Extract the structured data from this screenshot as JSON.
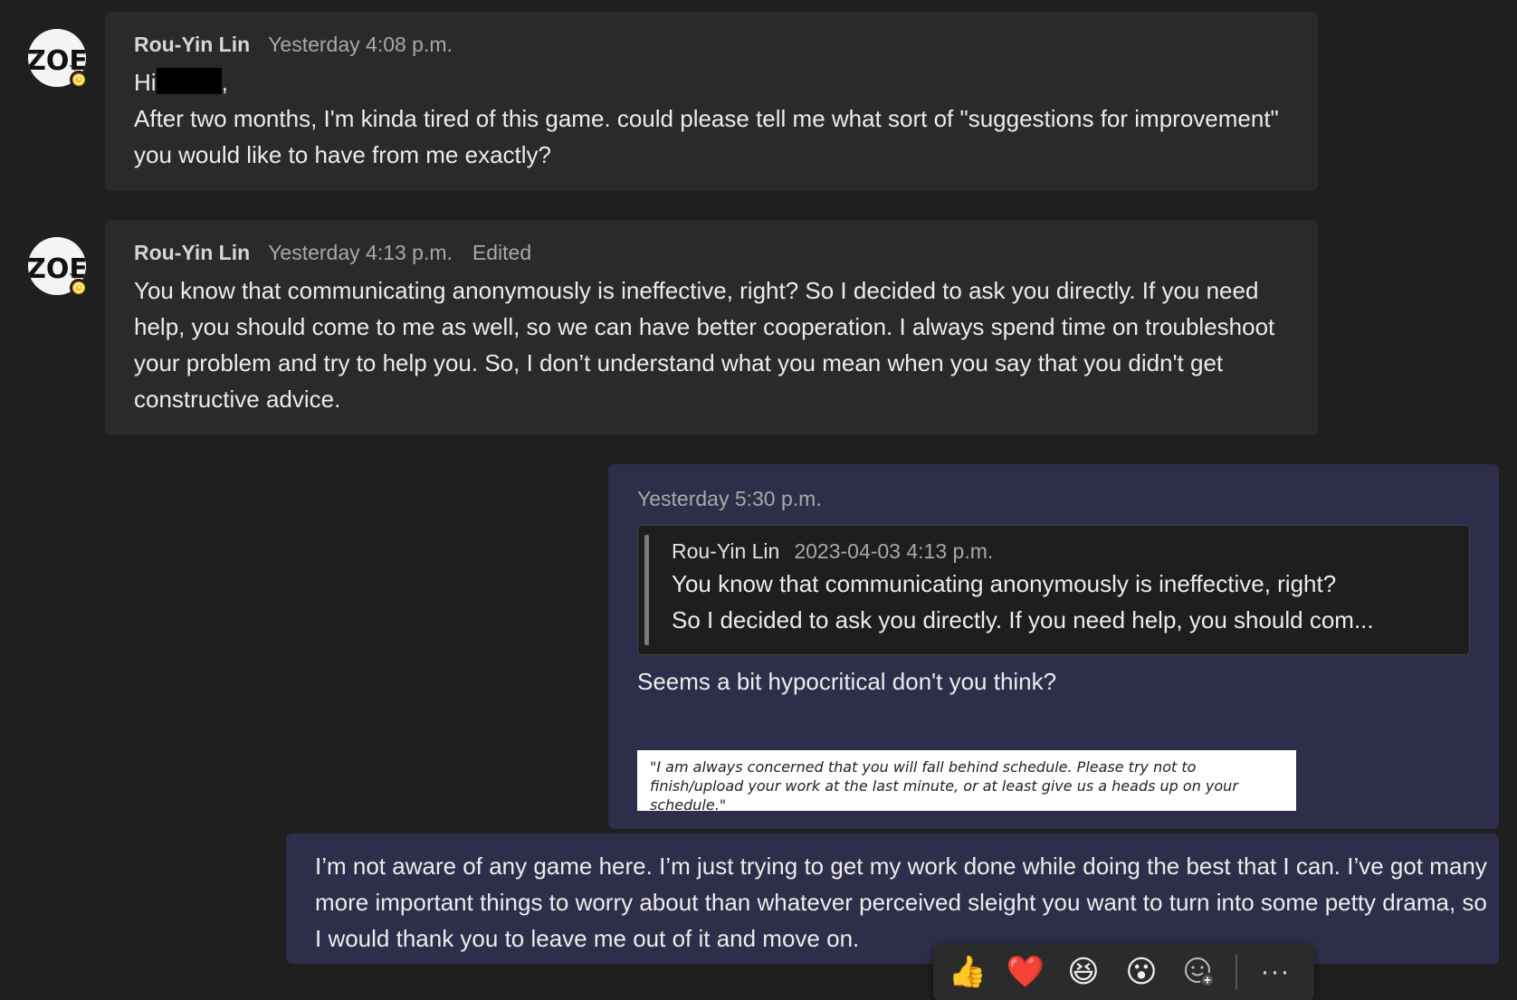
{
  "messages": [
    {
      "sender": "Rou-Yin Lin",
      "time": "Yesterday 4:08 p.m.",
      "greeting": "Hi",
      "greeting_suffix": ",",
      "body": "After two months, I'm kinda tired of this game. could please tell me what sort of \"suggestions for improvement\" you would like to have from me exactly?",
      "avatar_text": "ZOE"
    },
    {
      "sender": "Rou-Yin Lin",
      "time": "Yesterday 4:13 p.m.",
      "edited": "Edited",
      "body": "You know that communicating anonymously is ineffective, right? So I decided to ask you directly. If you need help, you should come to me as well, so we can have better cooperation. I always spend time on troubleshoot your problem and try to help you. So, I don’t understand what you mean when you say that you didn't get constructive advice.",
      "avatar_text": "ZOE"
    }
  ],
  "reply": {
    "time": "Yesterday 5:30 p.m.",
    "quote": {
      "sender": "Rou-Yin Lin",
      "time": "2023-04-03 4:13 p.m.",
      "line1": "You know that communicating anonymously is ineffective, right?",
      "line2": "So I decided to ask you directly. If you need help, you should com..."
    },
    "body": "Seems a bit hypocritical don't you think?",
    "image_text": "\"I am always concerned that you will fall behind schedule. Please try not to finish/upload your work at the last minute, or at least give us a heads up on your schedule.\""
  },
  "followup": {
    "body": "I’m not aware of any game here. I’m just trying to get my work done while doing the best that I can. I’ve got many more important things to worry about than whatever perceived sleight you want to turn into some petty drama, so I would thank you to leave me out of it and move on."
  },
  "reactions": [
    {
      "name": "like",
      "glyph": "👍"
    },
    {
      "name": "heart",
      "glyph": "❤️"
    },
    {
      "name": "laugh",
      "glyph": "😆"
    },
    {
      "name": "surprised",
      "glyph": "😮"
    }
  ],
  "more_label": "···",
  "colors": {
    "background": "#1f1f1f",
    "incoming_bubble": "#2a2a2a",
    "outgoing_bubble": "#2e2e4a",
    "presence_away": "#f2b705"
  }
}
